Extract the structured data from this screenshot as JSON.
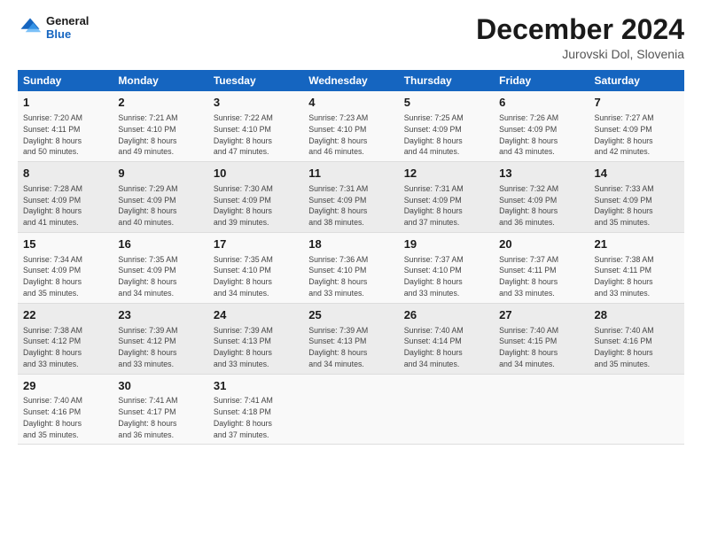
{
  "header": {
    "logo_line1": "General",
    "logo_line2": "Blue",
    "month_year": "December 2024",
    "location": "Jurovski Dol, Slovenia"
  },
  "weekdays": [
    "Sunday",
    "Monday",
    "Tuesday",
    "Wednesday",
    "Thursday",
    "Friday",
    "Saturday"
  ],
  "weeks": [
    [
      {
        "day": "1",
        "info": "Sunrise: 7:20 AM\nSunset: 4:11 PM\nDaylight: 8 hours\nand 50 minutes."
      },
      {
        "day": "2",
        "info": "Sunrise: 7:21 AM\nSunset: 4:10 PM\nDaylight: 8 hours\nand 49 minutes."
      },
      {
        "day": "3",
        "info": "Sunrise: 7:22 AM\nSunset: 4:10 PM\nDaylight: 8 hours\nand 47 minutes."
      },
      {
        "day": "4",
        "info": "Sunrise: 7:23 AM\nSunset: 4:10 PM\nDaylight: 8 hours\nand 46 minutes."
      },
      {
        "day": "5",
        "info": "Sunrise: 7:25 AM\nSunset: 4:09 PM\nDaylight: 8 hours\nand 44 minutes."
      },
      {
        "day": "6",
        "info": "Sunrise: 7:26 AM\nSunset: 4:09 PM\nDaylight: 8 hours\nand 43 minutes."
      },
      {
        "day": "7",
        "info": "Sunrise: 7:27 AM\nSunset: 4:09 PM\nDaylight: 8 hours\nand 42 minutes."
      }
    ],
    [
      {
        "day": "8",
        "info": "Sunrise: 7:28 AM\nSunset: 4:09 PM\nDaylight: 8 hours\nand 41 minutes."
      },
      {
        "day": "9",
        "info": "Sunrise: 7:29 AM\nSunset: 4:09 PM\nDaylight: 8 hours\nand 40 minutes."
      },
      {
        "day": "10",
        "info": "Sunrise: 7:30 AM\nSunset: 4:09 PM\nDaylight: 8 hours\nand 39 minutes."
      },
      {
        "day": "11",
        "info": "Sunrise: 7:31 AM\nSunset: 4:09 PM\nDaylight: 8 hours\nand 38 minutes."
      },
      {
        "day": "12",
        "info": "Sunrise: 7:31 AM\nSunset: 4:09 PM\nDaylight: 8 hours\nand 37 minutes."
      },
      {
        "day": "13",
        "info": "Sunrise: 7:32 AM\nSunset: 4:09 PM\nDaylight: 8 hours\nand 36 minutes."
      },
      {
        "day": "14",
        "info": "Sunrise: 7:33 AM\nSunset: 4:09 PM\nDaylight: 8 hours\nand 35 minutes."
      }
    ],
    [
      {
        "day": "15",
        "info": "Sunrise: 7:34 AM\nSunset: 4:09 PM\nDaylight: 8 hours\nand 35 minutes."
      },
      {
        "day": "16",
        "info": "Sunrise: 7:35 AM\nSunset: 4:09 PM\nDaylight: 8 hours\nand 34 minutes."
      },
      {
        "day": "17",
        "info": "Sunrise: 7:35 AM\nSunset: 4:10 PM\nDaylight: 8 hours\nand 34 minutes."
      },
      {
        "day": "18",
        "info": "Sunrise: 7:36 AM\nSunset: 4:10 PM\nDaylight: 8 hours\nand 33 minutes."
      },
      {
        "day": "19",
        "info": "Sunrise: 7:37 AM\nSunset: 4:10 PM\nDaylight: 8 hours\nand 33 minutes."
      },
      {
        "day": "20",
        "info": "Sunrise: 7:37 AM\nSunset: 4:11 PM\nDaylight: 8 hours\nand 33 minutes."
      },
      {
        "day": "21",
        "info": "Sunrise: 7:38 AM\nSunset: 4:11 PM\nDaylight: 8 hours\nand 33 minutes."
      }
    ],
    [
      {
        "day": "22",
        "info": "Sunrise: 7:38 AM\nSunset: 4:12 PM\nDaylight: 8 hours\nand 33 minutes."
      },
      {
        "day": "23",
        "info": "Sunrise: 7:39 AM\nSunset: 4:12 PM\nDaylight: 8 hours\nand 33 minutes."
      },
      {
        "day": "24",
        "info": "Sunrise: 7:39 AM\nSunset: 4:13 PM\nDaylight: 8 hours\nand 33 minutes."
      },
      {
        "day": "25",
        "info": "Sunrise: 7:39 AM\nSunset: 4:13 PM\nDaylight: 8 hours\nand 34 minutes."
      },
      {
        "day": "26",
        "info": "Sunrise: 7:40 AM\nSunset: 4:14 PM\nDaylight: 8 hours\nand 34 minutes."
      },
      {
        "day": "27",
        "info": "Sunrise: 7:40 AM\nSunset: 4:15 PM\nDaylight: 8 hours\nand 34 minutes."
      },
      {
        "day": "28",
        "info": "Sunrise: 7:40 AM\nSunset: 4:16 PM\nDaylight: 8 hours\nand 35 minutes."
      }
    ],
    [
      {
        "day": "29",
        "info": "Sunrise: 7:40 AM\nSunset: 4:16 PM\nDaylight: 8 hours\nand 35 minutes."
      },
      {
        "day": "30",
        "info": "Sunrise: 7:41 AM\nSunset: 4:17 PM\nDaylight: 8 hours\nand 36 minutes."
      },
      {
        "day": "31",
        "info": "Sunrise: 7:41 AM\nSunset: 4:18 PM\nDaylight: 8 hours\nand 37 minutes."
      },
      {
        "day": "",
        "info": ""
      },
      {
        "day": "",
        "info": ""
      },
      {
        "day": "",
        "info": ""
      },
      {
        "day": "",
        "info": ""
      }
    ]
  ]
}
